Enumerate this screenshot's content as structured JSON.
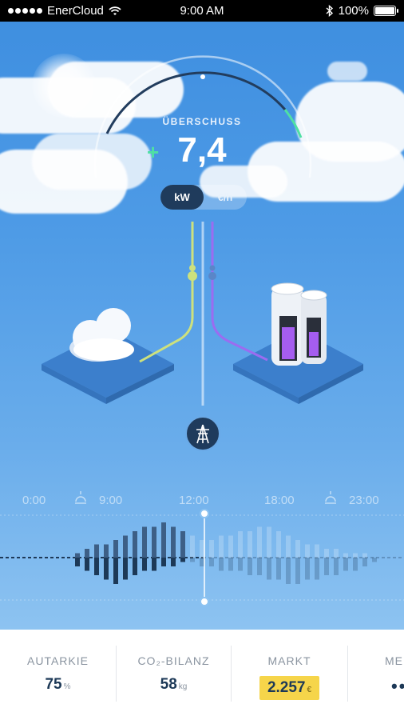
{
  "status_bar": {
    "carrier": "EnerCloud",
    "time": "9:00 AM",
    "battery": "100%"
  },
  "gauge": {
    "label": "ÜBERSCHUSS",
    "sign": "+",
    "value": "7,4",
    "level_fraction": 0.82
  },
  "unit_toggle": {
    "options": [
      "kW",
      "€/h"
    ],
    "selected": "kW"
  },
  "flow": {
    "left_node": "cloud",
    "right_node": "battery",
    "center_node": "power-grid-icon"
  },
  "timeline": {
    "labels": [
      "0:00",
      "9:00",
      "12:00",
      "18:00",
      "23:00"
    ],
    "sunrise_icon": "sunrise-icon",
    "sunset_icon": "sunset-icon"
  },
  "chart_data": {
    "type": "bar",
    "x": [
      "6:30",
      "7:00",
      "7:30",
      "8:00",
      "8:30",
      "9:00",
      "9:30",
      "10:00",
      "10:30",
      "11:00",
      "11:30",
      "12:00",
      "12:30",
      "13:00",
      "13:30",
      "14:00",
      "14:30",
      "15:00",
      "15:30",
      "16:00",
      "16:30",
      "17:00",
      "17:30",
      "18:00",
      "18:30",
      "19:00",
      "19:30",
      "20:00",
      "20:30",
      "21:00",
      "21:30",
      "22:00"
    ],
    "series": [
      {
        "values": [
          1,
          2,
          3,
          3,
          4,
          5,
          6,
          7,
          7,
          8,
          7,
          6,
          5,
          4,
          4,
          5,
          5,
          6,
          6,
          7,
          7,
          6,
          5,
          4,
          3,
          3,
          2,
          2,
          1,
          1,
          1,
          0
        ]
      },
      {
        "values": [
          -2,
          -3,
          -4,
          -5,
          -6,
          -5,
          -4,
          -3,
          -3,
          -2,
          -2,
          -1,
          -1,
          -2,
          -2,
          -3,
          -3,
          -3,
          -4,
          -4,
          -5,
          -5,
          -6,
          -6,
          -5,
          -5,
          -4,
          -4,
          -3,
          -3,
          -2,
          -1
        ]
      }
    ],
    "current": "12:00"
  },
  "kpis": [
    {
      "label": "AUTARKIE",
      "value": "75",
      "unit": "%"
    },
    {
      "label": "CO₂-BILANZ",
      "value": "58",
      "unit": "kg"
    },
    {
      "label": "MARKT",
      "value": "2.257",
      "unit": "€"
    },
    {
      "label": "ME",
      "value": "••"
    }
  ],
  "colors": {
    "accent_green": "#4fe0a3",
    "dark_navy": "#1f3b5c",
    "market_yellow": "#f6d54a",
    "flow_yellow": "#cde17d",
    "flow_purple": "#9b6cf0"
  }
}
